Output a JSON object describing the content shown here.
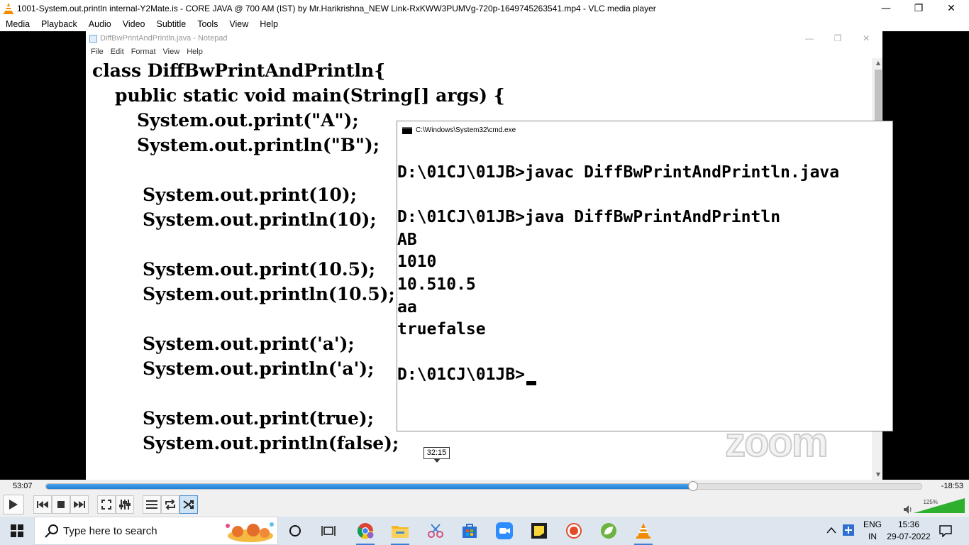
{
  "window": {
    "title": "1001-System.out.println internal-Y2Mate.is - CORE JAVA @ 700 AM (IST) by Mr.Harikrishna_NEW Link-RxKWW3PUMVg-720p-1649745263541.mp4 - VLC media player",
    "app_icon": "vlc-cone-icon"
  },
  "menu": [
    "Media",
    "Playback",
    "Audio",
    "Video",
    "Subtitle",
    "Tools",
    "View",
    "Help"
  ],
  "notepad": {
    "title": "DiffBwPrintAndPrintln.java - Notepad",
    "menu": [
      "File",
      "Edit",
      "Format",
      "View",
      "Help"
    ],
    "code": [
      "class DiffBwPrintAndPrintln{",
      "public static void main(String[] args) {",
      "System.out.print(\"A\");",
      "System.out.println(\"B\");",
      "System.out.print(10);",
      "System.out.println(10);",
      "System.out.print(10.5);",
      "System.out.println(10.5);",
      "System.out.print('a');",
      "System.out.println('a');",
      "System.out.print(true);",
      "System.out.println(false);"
    ]
  },
  "cmd": {
    "title": "C:\\Windows\\System32\\cmd.exe",
    "lines": [
      "D:\\01CJ\\01JB>javac DiffBwPrintAndPrintln.java",
      "D:\\01CJ\\01JB>java DiffBwPrintAndPrintln",
      "AB",
      "1010",
      "10.510.5",
      "aa",
      "truefalse",
      "D:\\01CJ\\01JB>"
    ]
  },
  "zoom_watermark": "zoom",
  "player": {
    "elapsed": "53:07",
    "remaining": "-18:53",
    "hover_time": "32:15",
    "progress_fraction": 0.7387,
    "volume_label": "125%",
    "volume_fraction": 1.0,
    "accent": "#1c7fd6"
  },
  "taskbar": {
    "search_placeholder": "Type here to search",
    "language": "ENG",
    "region": "IN",
    "time": "15:36",
    "date": "29-07-2022"
  }
}
